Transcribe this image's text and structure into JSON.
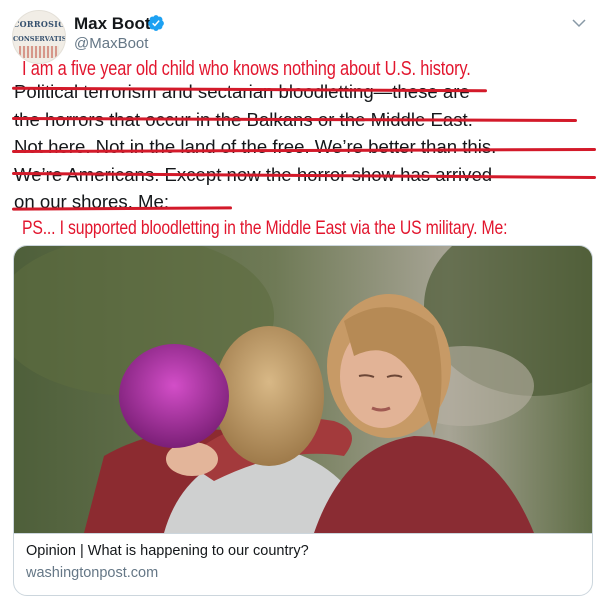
{
  "author": {
    "name": "Max Boot",
    "handle": "@MaxBoot",
    "avatar_text_top": "CORROSION",
    "avatar_text_bottom": "CONSERVATISM",
    "verified_color": "#1da1f2"
  },
  "tweet": {
    "lines": [
      "Political terrorism and sectarian bloodletting—these are",
      "the horrors that occur in the Balkans or the Middle East.",
      "Not here. Not in the land of the free. We’re better than this.",
      "We’re Americans.  Except now the horror show has arrived",
      "on our shores. Me:"
    ]
  },
  "overlay": {
    "line1": "I am a five year old child who knows nothing about U.S. history.",
    "line2": "PS... I supported bloodletting in the Middle East via the US military. Me:",
    "color": "#e2162e"
  },
  "card": {
    "title": "Opinion | What is happening to our country?",
    "domain": "washingtonpost.com"
  },
  "icons": {
    "verified": "verified-badge-icon",
    "menu": "chevron-down-icon"
  }
}
